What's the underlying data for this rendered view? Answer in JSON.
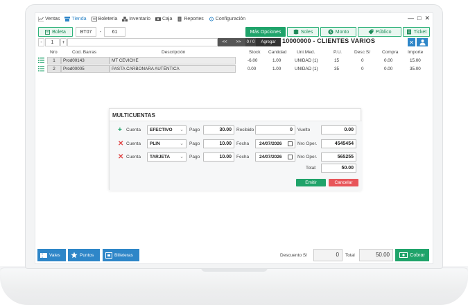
{
  "menu": [
    {
      "label": "Ventas",
      "icon": "chart-icon",
      "active": false
    },
    {
      "label": "Tienda",
      "icon": "store-icon",
      "active": true
    },
    {
      "label": "Boleteria",
      "icon": "ticket-icon",
      "active": false
    },
    {
      "label": "Inventario",
      "icon": "boxes-icon",
      "active": false
    },
    {
      "label": "Caja",
      "icon": "cash-icon",
      "active": false
    },
    {
      "label": "Reportes",
      "icon": "report-icon",
      "active": false
    },
    {
      "label": "Configuración",
      "icon": "gear-icon",
      "active": false
    }
  ],
  "window_controls": {
    "minimize": "—",
    "maximize": "□",
    "close": "✕"
  },
  "toolbar": {
    "doc_type": "Boleta",
    "series": "BT07",
    "dash": "-",
    "number": "61",
    "mas_opciones": "Más Opciones",
    "currency": "Soles",
    "monto": "Monto",
    "publico": "Público",
    "ticket": "Ticket"
  },
  "row2": {
    "minus": "-",
    "qty": "1",
    "plus": "+",
    "prev": "<<",
    "next": ">>",
    "counter": "0 / 0",
    "agregar": "Agregar",
    "client": "10000000 - CLIENTES VARIOS",
    "clear": "✕"
  },
  "table": {
    "headers": [
      "Nro",
      "Cod. Barras",
      "Descripción",
      "Stock",
      "Cantidad",
      "Uni.Med.",
      "P.U.",
      "Desc S/",
      "Compra",
      "Importe"
    ],
    "rows": [
      {
        "nro": "1",
        "code": "Prod00143",
        "desc": "MT CEVICHE",
        "stock": "-6.00",
        "qty": "1.00",
        "unit": "UNIDAD (1)",
        "pu": "15",
        "desc_s": "0",
        "compra": "0.00",
        "importe": "15.00"
      },
      {
        "nro": "2",
        "code": "Prod00005",
        "desc": "PASTA CARBONARA AUTÉNTICA",
        "stock": "0.00",
        "qty": "1.00",
        "unit": "UNIDAD (1)",
        "pu": "35",
        "desc_s": "0",
        "compra": "0.00",
        "importe": "35.00"
      }
    ]
  },
  "modal": {
    "title": "MULTICUENTAS",
    "rows": [
      {
        "sign": "+",
        "cuenta_label": "Cuenta",
        "method": "EFECTIVO",
        "pago_label": "Pago",
        "pago": "30.00",
        "mid_label": "Recibido",
        "mid_value": "0",
        "right_label": "Vuelto",
        "right_value": "0.00"
      },
      {
        "sign": "✕",
        "cuenta_label": "Cuenta",
        "method": "PLIN",
        "pago_label": "Pago",
        "pago": "10.00",
        "mid_label": "Fecha",
        "mid_value": "24/07/2026",
        "right_label": "Nro Oper.",
        "right_value": "4545454"
      },
      {
        "sign": "✕",
        "cuenta_label": "Cuenta",
        "method": "TARJETA",
        "pago_label": "Pago",
        "pago": "10.00",
        "mid_label": "Fecha",
        "mid_value": "24/07/2026",
        "right_label": "Nro Oper.",
        "right_value": "565255"
      }
    ],
    "total_label": "Total:",
    "total": "50.00",
    "emit": "Emitir",
    "cancel": "Cancelar"
  },
  "bottom": {
    "vales": "Vales",
    "puntos": "Puntos",
    "billeteras": "Billeteras",
    "descuento_label": "Descuento S/",
    "descuento": "0",
    "total_label": "Total",
    "total": "50.00",
    "cobrar": "Cobrar"
  },
  "colors": {
    "green": "#1fa36a",
    "blue": "#2e86c8",
    "red": "#e04848"
  }
}
